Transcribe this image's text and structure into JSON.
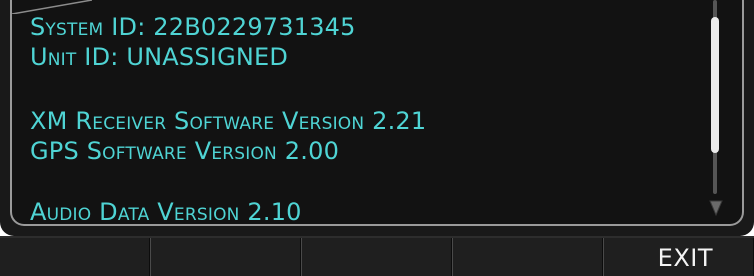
{
  "info": {
    "system_id": "System ID: 22B0229731345",
    "unit_id": "Unit ID: UNASSIGNED",
    "xm_software": "XM Receiver Software Version 2.21",
    "gps_software": "GPS Software Version 2.00",
    "audio_data": "Audio Data Version 2.10"
  },
  "scrollbar": {
    "scroll_position_fraction": 0.3,
    "arrow_icon": "chevron-down-icon"
  },
  "softkeys": {
    "key1": "",
    "key2": "",
    "key3": "",
    "key4": "",
    "key5": "EXIT"
  },
  "colors": {
    "text_cyan": "#4fd4d4",
    "background": "#121212",
    "softkey_text": "#f4f4f4"
  }
}
